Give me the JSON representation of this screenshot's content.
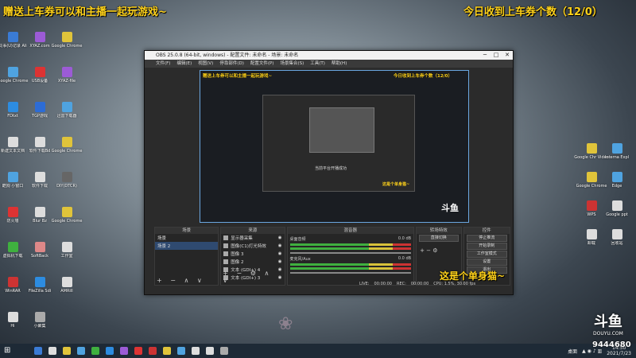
{
  "overlay": {
    "left_title": "赠送上车券可以和主播一起玩游戏~",
    "right_title": "今日收到上车券个数（12/0）",
    "side_tag": "这是个单身猫~",
    "inner_title_small": "上车券可以和主播一起玩游戏~",
    "inner_right_small": "今日收到上车券个数（12/0）",
    "inner_mid_small": "这是个单身猫~",
    "inner_popup": "当前平台开播成功"
  },
  "desktop_left": [
    {
      "label": "同事(U)记录 Ali",
      "color": "#3a7bd5"
    },
    {
      "label": "XYAZ.com",
      "color": "#9c5bd6"
    },
    {
      "label": "Google Chrome",
      "color": "#e0c43a"
    },
    {
      "label": "Google Chrome",
      "color": "#4fa3e0"
    },
    {
      "label": "USB设备",
      "color": "#d33"
    },
    {
      "label": "XYAZ-file",
      "color": "#9c5bd6"
    },
    {
      "label": "FDtxt",
      "color": "#2d8ce0"
    },
    {
      "label": "TGP游戏",
      "color": "#2d6cd5"
    },
    {
      "label": "迅雷下载器",
      "color": "#4fa3e0"
    },
    {
      "label": "新建文本文档",
      "color": "#ddd"
    },
    {
      "label": "软件下载Bd",
      "color": "#ddd"
    },
    {
      "label": "Google Chrome",
      "color": "#e0c43a"
    },
    {
      "label": "酷狗 小窗口",
      "color": "#4fa3e0"
    },
    {
      "label": "软件下载",
      "color": "#ddd"
    },
    {
      "label": "DIY(DTCR)",
      "color": "#666"
    },
    {
      "label": "防火墙",
      "color": "#d33"
    },
    {
      "label": "Blur Bz",
      "color": "#ddd"
    },
    {
      "label": "Google Chrome",
      "color": "#e0c43a"
    },
    {
      "label": "虚拟机下载",
      "color": "#3fb03f"
    },
    {
      "label": "SoftBack",
      "color": "#d88"
    },
    {
      "label": "工作室",
      "color": "#ddd"
    },
    {
      "label": "WinRAR",
      "color": "#c33"
    },
    {
      "label": "FileZilla Sdi",
      "color": "#2d8ce0"
    },
    {
      "label": "AMRiII",
      "color": "#ddd"
    },
    {
      "label": "Hi",
      "color": "#ddd"
    },
    {
      "label": "小聚集",
      "color": "#aaa"
    }
  ],
  "desktop_right": [
    {
      "label": "Google Chr Video",
      "color": "#e0c43a"
    },
    {
      "label": "Interna Expl",
      "color": "#4fa3e0"
    },
    {
      "label": "Google Chrome",
      "color": "#e0c43a"
    },
    {
      "label": "Edge",
      "color": "#4fa3e0"
    },
    {
      "label": "WPS",
      "color": "#c33"
    },
    {
      "label": "Google ppt",
      "color": "#ddd"
    },
    {
      "label": "卸载",
      "color": "#ddd"
    },
    {
      "label": "回收站",
      "color": "#ddd"
    }
  ],
  "obs": {
    "title": "OBS 25.0.8 (64-bit, windows) - 配置文件: 未命名 - 场景: 未命名",
    "menu": [
      "文件(F)",
      "编辑(E)",
      "视图(V)",
      "停靠部件(D)",
      "配置文件(P)",
      "场景集合(S)",
      "工具(T)",
      "帮助(H)"
    ],
    "win_min": "─",
    "win_max": "□",
    "win_close": "✕",
    "docks": {
      "scenes": "场景",
      "sources": "来源",
      "mixer": "混音器",
      "transitions": "转场特效",
      "controls": "控件"
    },
    "scenes": [
      "场景",
      "场景 2"
    ],
    "sources": [
      "显示器采集",
      "图像(C1)灯光特效",
      "图像 3",
      "图像 2",
      "文本 (GDI+) 4",
      "文本 (GDI+) 3"
    ],
    "mixer_tracks": [
      {
        "name": "桌面音频",
        "db": "0.0 dB"
      },
      {
        "name": "麦克风/Aux",
        "db": "0.0 dB"
      }
    ],
    "transition": "直接切换",
    "control_buttons": [
      "停止推流",
      "开始录制",
      "工作室模式",
      "设置",
      "退出"
    ],
    "status": {
      "live_label": "LIVE:",
      "live_time": "00:00:00",
      "rec_label": "REC:",
      "rec_time": "00:00:00",
      "cpu": "CPU: 1.5%, 30.00 fps"
    }
  },
  "logo": {
    "glyph": "斗鱼",
    "text": "DOUYU.COM"
  },
  "viewer_count": "9444680",
  "taskbar": {
    "clock_time": "14:50",
    "clock_date": "2021/7/23",
    "tray_label": "桌面"
  },
  "taskbar_buttons": [
    "#3a7bd5",
    "#ddd",
    "#e0c43a",
    "#4fa3e0",
    "#3fb03f",
    "#2d8ce0",
    "#9c5bd6",
    "#d33",
    "#c33",
    "#e0c43a",
    "#4fa3e0",
    "#ddd",
    "#ddd",
    "#aaa"
  ]
}
